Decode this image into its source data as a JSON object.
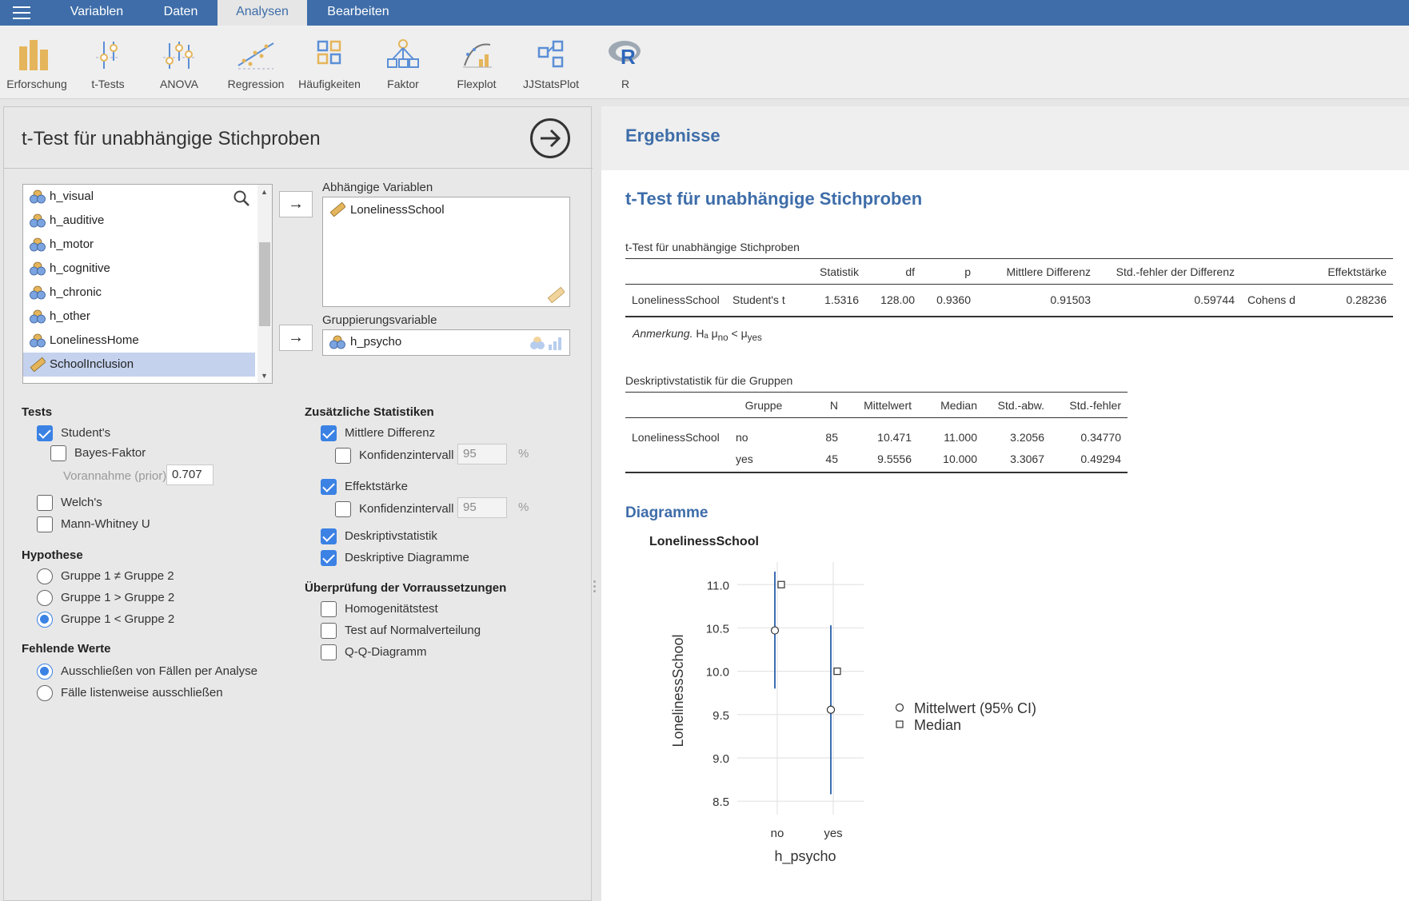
{
  "menu": {
    "tabs": [
      {
        "label": "Variablen"
      },
      {
        "label": "Daten"
      },
      {
        "label": "Analysen"
      },
      {
        "label": "Bearbeiten"
      }
    ],
    "active_tab": "Analysen"
  },
  "ribbon": {
    "buttons": [
      {
        "label": "Erforschung",
        "icon": "bar-chart-icon"
      },
      {
        "label": "t-Tests",
        "icon": "t-tests-icon"
      },
      {
        "label": "ANOVA",
        "icon": "anova-icon"
      },
      {
        "label": "Regression",
        "icon": "regression-icon"
      },
      {
        "label": "Häufigkeiten",
        "icon": "frequencies-icon"
      },
      {
        "label": "Faktor",
        "icon": "factor-icon"
      },
      {
        "label": "Flexplot",
        "icon": "flexplot-icon"
      },
      {
        "label": "JJStatsPlot",
        "icon": "jjstatsplot-icon"
      },
      {
        "label": "R",
        "icon": "r-logo-icon"
      }
    ]
  },
  "analysis": {
    "title": "t-Test für unabhängige Stichproben",
    "variables": [
      {
        "name": "h_visual",
        "type": "nominal"
      },
      {
        "name": "h_auditive",
        "type": "nominal"
      },
      {
        "name": "h_motor",
        "type": "nominal"
      },
      {
        "name": "h_cognitive",
        "type": "nominal"
      },
      {
        "name": "h_chronic",
        "type": "nominal"
      },
      {
        "name": "h_other",
        "type": "nominal"
      },
      {
        "name": "LonelinessHome",
        "type": "nominal"
      },
      {
        "name": "SchoolInclusion",
        "type": "continuous",
        "selected": true
      }
    ],
    "dependent_label": "Abhängige Variablen",
    "dependent_vars": [
      "LonelinessSchool"
    ],
    "grouping_label": "Gruppierungsvariable",
    "grouping_var": "h_psycho",
    "tests": {
      "heading": "Tests",
      "students": {
        "label": "Student's",
        "checked": true
      },
      "bayes": {
        "label": "Bayes-Faktor",
        "checked": false
      },
      "prior_label": "Vorannahme (prior)",
      "prior_value": "0.707",
      "welch": {
        "label": "Welch's",
        "checked": false
      },
      "mann": {
        "label": "Mann-Whitney U",
        "checked": false
      }
    },
    "hypothesis": {
      "heading": "Hypothese",
      "options": [
        {
          "label": "Gruppe 1 ≠ Gruppe 2",
          "checked": false
        },
        {
          "label": "Gruppe 1 > Gruppe 2",
          "checked": false
        },
        {
          "label": "Gruppe 1 < Gruppe 2",
          "checked": true
        }
      ]
    },
    "missing": {
      "heading": "Fehlende Werte",
      "options": [
        {
          "label": "Ausschließen von Fällen per Analyse",
          "checked": true
        },
        {
          "label": "Fälle listenweise ausschließen",
          "checked": false
        }
      ]
    },
    "additional": {
      "heading": "Zusätzliche Statistiken",
      "mean_diff": {
        "label": "Mittlere Differenz",
        "checked": true
      },
      "ci1": {
        "label": "Konfidenzintervall",
        "checked": false,
        "value": "95",
        "unit": "%"
      },
      "effect": {
        "label": "Effektstärke",
        "checked": true
      },
      "ci2": {
        "label": "Konfidenzintervall",
        "checked": false,
        "value": "95",
        "unit": "%"
      },
      "desc": {
        "label": "Deskriptivstatistik",
        "checked": true
      },
      "desc_plots": {
        "label": "Deskriptive Diagramme",
        "checked": true
      }
    },
    "assumptions": {
      "heading": "Überprüfung der Vorraussetzungen",
      "homog": {
        "label": "Homogenitätstest",
        "checked": false
      },
      "normal": {
        "label": "Test auf Normalverteilung",
        "checked": false
      },
      "qq": {
        "label": "Q-Q-Diagramm",
        "checked": false
      }
    }
  },
  "results": {
    "title": "Ergebnisse",
    "heading": "t-Test für unabhängige Stichproben",
    "ttest_table": {
      "caption": "t-Test für unabhängige Stichproben",
      "headers": [
        "",
        "",
        "Statistik",
        "df",
        "p",
        "Mittlere Differenz",
        "Std.-fehler der Differenz",
        "",
        "Effektstärke"
      ],
      "row": [
        "LonelinessSchool",
        "Student's t",
        "1.5316",
        "128.00",
        "0.9360",
        "0.91503",
        "0.59744",
        "Cohens d",
        "0.28236"
      ],
      "note_label": "Anmerkung.",
      "note_text": "Hₐ μ",
      "note_sub1": "no",
      "note_mid": " < μ",
      "note_sub2": "yes"
    },
    "desc_table": {
      "caption": "Deskriptivstatistik für die Gruppen",
      "headers": [
        "",
        "Gruppe",
        "N",
        "Mittelwert",
        "Median",
        "Std.-abw.",
        "Std.-fehler"
      ],
      "rows": [
        [
          "LonelinessSchool",
          "no",
          "85",
          "10.471",
          "11.000",
          "3.2056",
          "0.34770"
        ],
        [
          "",
          "yes",
          "45",
          "9.5556",
          "10.000",
          "3.3067",
          "0.49294"
        ]
      ]
    },
    "plots_heading": "Diagramme"
  },
  "chart_data": {
    "type": "scatter",
    "title": "LonelinessSchool",
    "xlabel": "h_psycho",
    "ylabel": "LonelinessSchool",
    "categories": [
      "no",
      "yes"
    ],
    "ylim": [
      8.4,
      11.15
    ],
    "yticks": [
      "8.5",
      "9.0",
      "9.5",
      "10.0",
      "10.5",
      "11.0"
    ],
    "series": [
      {
        "name": "Mittelwert (95% CI)",
        "values": [
          10.471,
          9.5556
        ],
        "ci_low": [
          9.8,
          8.58
        ],
        "ci_high": [
          11.15,
          10.53
        ]
      },
      {
        "name": "Median",
        "values": [
          11.0,
          10.0
        ]
      }
    ],
    "grid": true,
    "legend": "right"
  }
}
